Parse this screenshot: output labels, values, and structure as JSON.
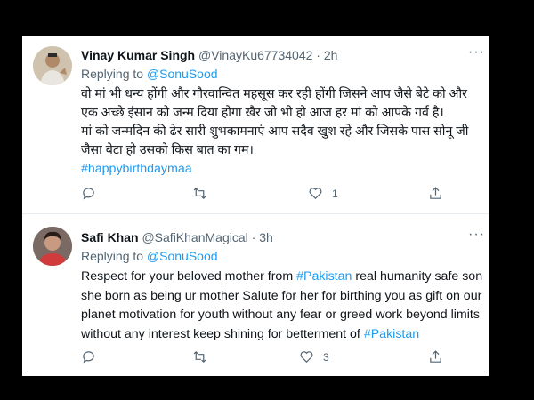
{
  "tweets": [
    {
      "name": "Vinay Kumar Singh",
      "handle": "@VinayKu67734042",
      "separator": "·",
      "time": "2h",
      "more": "···",
      "replying_prefix": "Replying to",
      "replying_to": "@SonuSood",
      "lines": [
        "वो मां भी धन्य होंगी और गौरवान्वित महसूस कर रही होंगी जिसने आप जैसे बेटे को और",
        "एक अच्छे इंसान को जन्म दिया होगा खैर जो भी हो आज हर मां को आपके गर्व है।",
        "मां को जन्मदिन की ढेर सारी शुभकामनाएं आप सदैव खुश रहे और जिसके पास सोनू जी",
        "जैसा बेटा हो उसको किस बात का गम।"
      ],
      "hashtag": "#happybirthdaymaa",
      "likes": "1"
    },
    {
      "name": "Safi Khan",
      "handle": "@SafiKhanMagical",
      "separator": "·",
      "time": "3h",
      "more": "···",
      "replying_prefix": "Replying to",
      "replying_to": "@SonuSood",
      "line1_a": "Respect for your beloved mother from ",
      "line1_tag": "#Pakistan",
      "line1_b": " real humanity safe son",
      "line2": "she born as being ur mother Salute for her for birthing you as gift on our",
      "line3": "planet motivation for youth without any fear or greed work beyond limits",
      "line4_a": "without any interest keep shining for betterment of ",
      "line4_tag": "#Pakistan",
      "likes": "3"
    }
  ],
  "icons": [
    "comment-icon",
    "retweet-icon",
    "heart-icon",
    "share-icon",
    "more-icon"
  ],
  "colors": {
    "link": "#1d9bf0",
    "text": "#0f1419",
    "secondary": "#536471",
    "background": "#000000"
  }
}
